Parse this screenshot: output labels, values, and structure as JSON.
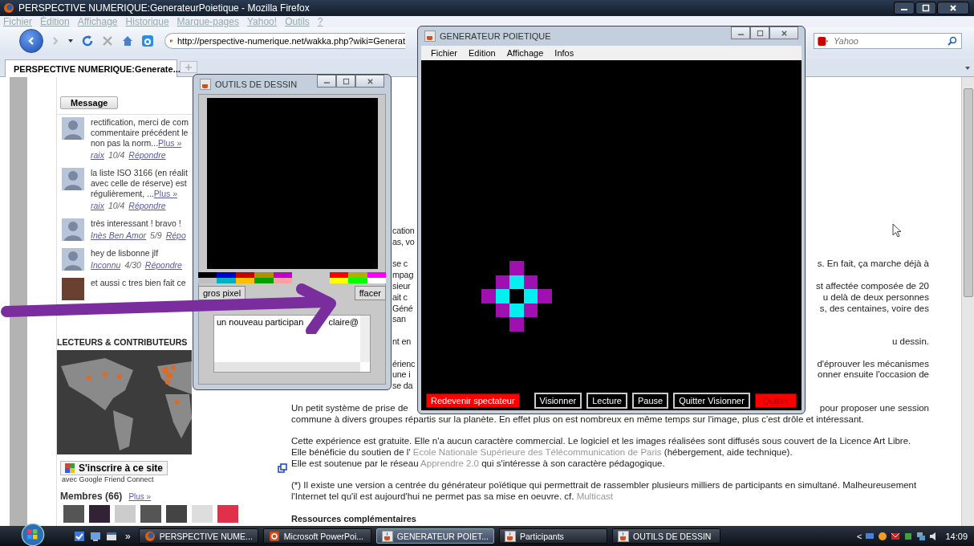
{
  "browser": {
    "title": "PERSPECTIVE NUMERIQUE:GenerateurPoietique - Mozilla Firefox",
    "menu": [
      "Fichier",
      "Édition",
      "Affichage",
      "Historique",
      "Marque-pages",
      "Yahoo!",
      "Outils",
      "?"
    ],
    "url": "http://perspective-numerique.net/wakka.php?wiki=Generat",
    "search": {
      "placeholder": "Yahoo"
    },
    "tabs": [
      {
        "label": "PERSPECTIVE NUMERIQUE:Generate...",
        "selected": true
      }
    ]
  },
  "sidebar": {
    "message_button": "Message",
    "comments": [
      {
        "kind": "silhouette",
        "lines": [
          "rectification, merci de com",
          "commentaire précédent le",
          "non pas la norm..."
        ],
        "more": "Plus »",
        "author": "raix",
        "date": "10/4",
        "reply": "Répondre"
      },
      {
        "kind": "silhouette",
        "lines": [
          "la liste ISO 3166 (en réalit",
          "avec celle de réserve) est",
          "régulièrement, ..."
        ],
        "more": "Plus »",
        "author": "raix",
        "date": "10/4",
        "reply": "Répondre"
      },
      {
        "kind": "silhouette",
        "lines": [
          "très interessant ! bravo !"
        ],
        "author": "Inès Ben Amor",
        "date": "5/9",
        "reply": "Répo"
      },
      {
        "kind": "silhouette",
        "lines": [
          "hey de lisbonne jlf"
        ],
        "author": "Inconnu",
        "date": "4/30",
        "reply": "Répondre"
      },
      {
        "kind": "photo",
        "lines": [
          "et aussi c tres bien fait ce"
        ]
      }
    ],
    "readers_heading": "LECTEURS & CONTRIBUTEURS",
    "join_button": "S'inscrire à ce site",
    "join_note": "avec Google Friend Connect",
    "members": {
      "label": "Membres (66)",
      "more": "Plus »"
    }
  },
  "article": {
    "paragraphs": [
      {
        "lines": [
          {
            "left": "cation"
          },
          {
            "left": "as, vo"
          }
        ]
      },
      {
        "lines": [
          {
            "left": "se c",
            "right": "s. En fait, ça marche déjà à"
          },
          {
            "left": "mpag"
          },
          {
            "left": "sieur",
            "right": "st affectée composée de 20"
          },
          {
            "left": "ait c",
            "right": "u delà de deux personnes"
          },
          {
            "left": "Géné",
            "right": "s, des centaines, voire des"
          },
          {
            "left": "san"
          }
        ]
      },
      {
        "lines": [
          {
            "left": "nt en",
            "right": "u dessin."
          }
        ]
      },
      {
        "lines": [
          {
            "left": "érienc",
            "right": "d'éprouver les mécanismes"
          },
          {
            "left": "une i",
            "right": "onner ensuite l'occasion de"
          },
          {
            "left": "se da"
          }
        ]
      }
    ],
    "intro": [
      {
        "left": "Un petit système de prise de",
        "right": "pour proposer une session"
      },
      {
        "left": "commune à divers groupes répartis sur la planète. En effet plus on est nombreux en même temps sur l'image, plus c'est drôle et intéressant."
      }
    ],
    "notes": [
      {
        "sentences": [
          [
            {
              "text": "Cette expérience est gratuite. Elle n'a aucun caractère commercial. Le logiciel et les images réalisées sont diffusés sous couvert de la Licence Art Libre.",
              "link": false
            }
          ],
          [
            {
              "text": "Elle bénéficie du soutien de l' ",
              "link": false
            },
            {
              "text": "Ecole Nationale Supérieure des Télécommunication de Paris",
              "link": true
            },
            {
              "text": " (hébergement, aide technique).",
              "link": false
            }
          ],
          [
            {
              "text": "Elle est soutenue par le réseau ",
              "link": false
            },
            {
              "text": "Apprendre 2.0",
              "link": true
            },
            {
              "text": " qui s'intéresse à son caractère pédagogique.",
              "link": false
            }
          ]
        ]
      },
      {
        "sentences": [
          [
            {
              "text": "(*) Il existe une version a centrée du générateur poïétique qui permettrait de rassembler plusieurs milliers de participants en simultané. Malheureusement l'Internet tel qu'il est aujourd'hui ne permet pas sa mise en oeuvre. cf. ",
              "link": false
            },
            {
              "text": "Multicast",
              "link": true
            }
          ]
        ]
      }
    ],
    "resources_heading": "Ressources complémentaires"
  },
  "tools_window": {
    "title": "OUTILS DE DESSIN",
    "palette": [
      {
        "left": [
          {
            "color": "#000000"
          },
          {
            "color": "#0000c8"
          },
          {
            "color": "#c80000"
          },
          {
            "color": "#b09000"
          },
          {
            "color": "#c000c8"
          }
        ],
        "right": [
          {
            "color": "#ff0000"
          },
          {
            "color": "#b0b000"
          },
          {
            "color": "#ff00ff"
          }
        ]
      },
      {
        "left": [
          {
            "color": "#c0c0c0"
          },
          {
            "color": "#00b0c0"
          },
          {
            "color": "#ffc000"
          },
          {
            "color": "#00a000"
          },
          {
            "color": "#ffa0a0"
          }
        ],
        "right": [
          {
            "color": "#ffff00"
          },
          {
            "color": "#00ff00"
          },
          {
            "color": "#ffffff"
          }
        ]
      }
    ],
    "buttons": [
      "gros pixel",
      "ffacer"
    ],
    "log": [
      "un nouveau participan",
      "claire@"
    ]
  },
  "generator_window": {
    "title": "GENERATEUR POIETIQUE",
    "menu": [
      "Fichier",
      "Edition",
      "Affichage",
      "Infos"
    ],
    "pixels": [
      {
        "cells": [
          null,
          null,
          {
            "color": "#a010b0"
          },
          null,
          null
        ]
      },
      {
        "cells": [
          null,
          {
            "color": "#a010b0"
          },
          {
            "color": "#00f0f0"
          },
          {
            "color": "#a010b0"
          },
          null
        ]
      },
      {
        "cells": [
          {
            "color": "#a010b0"
          },
          {
            "color": "#00f0f0"
          },
          null,
          {
            "color": "#00f0f0"
          },
          {
            "color": "#a010b0"
          }
        ]
      },
      {
        "cells": [
          null,
          {
            "color": "#a010b0"
          },
          {
            "color": "#00f0f0"
          },
          {
            "color": "#a010b0"
          },
          null
        ]
      },
      {
        "cells": [
          null,
          null,
          {
            "color": "#a010b0"
          },
          null,
          null
        ]
      }
    ],
    "buttons": [
      {
        "label": "Redevenir spectateur",
        "kind": "alert"
      },
      {
        "label": "Visionner",
        "kind": "outline"
      },
      {
        "label": "Lecture",
        "kind": "outline"
      },
      {
        "label": "Pause",
        "kind": "outline"
      },
      {
        "label": "Quitter Visionner",
        "kind": "outline"
      },
      {
        "label": "Quitter",
        "kind": "quit"
      }
    ]
  },
  "taskbar": {
    "overflow": "»",
    "items": [
      {
        "label": "PERSPECTIVE NUME...",
        "selected": false
      },
      {
        "label": "Microsoft PowerPoi...",
        "selected": false
      },
      {
        "label": "GENERATEUR POIET...",
        "selected": true
      },
      {
        "label": "Participants",
        "selected": false
      },
      {
        "label": "OUTILS DE DESSIN",
        "selected": false
      }
    ],
    "tray_toggle": "<",
    "clock": "14:09"
  }
}
